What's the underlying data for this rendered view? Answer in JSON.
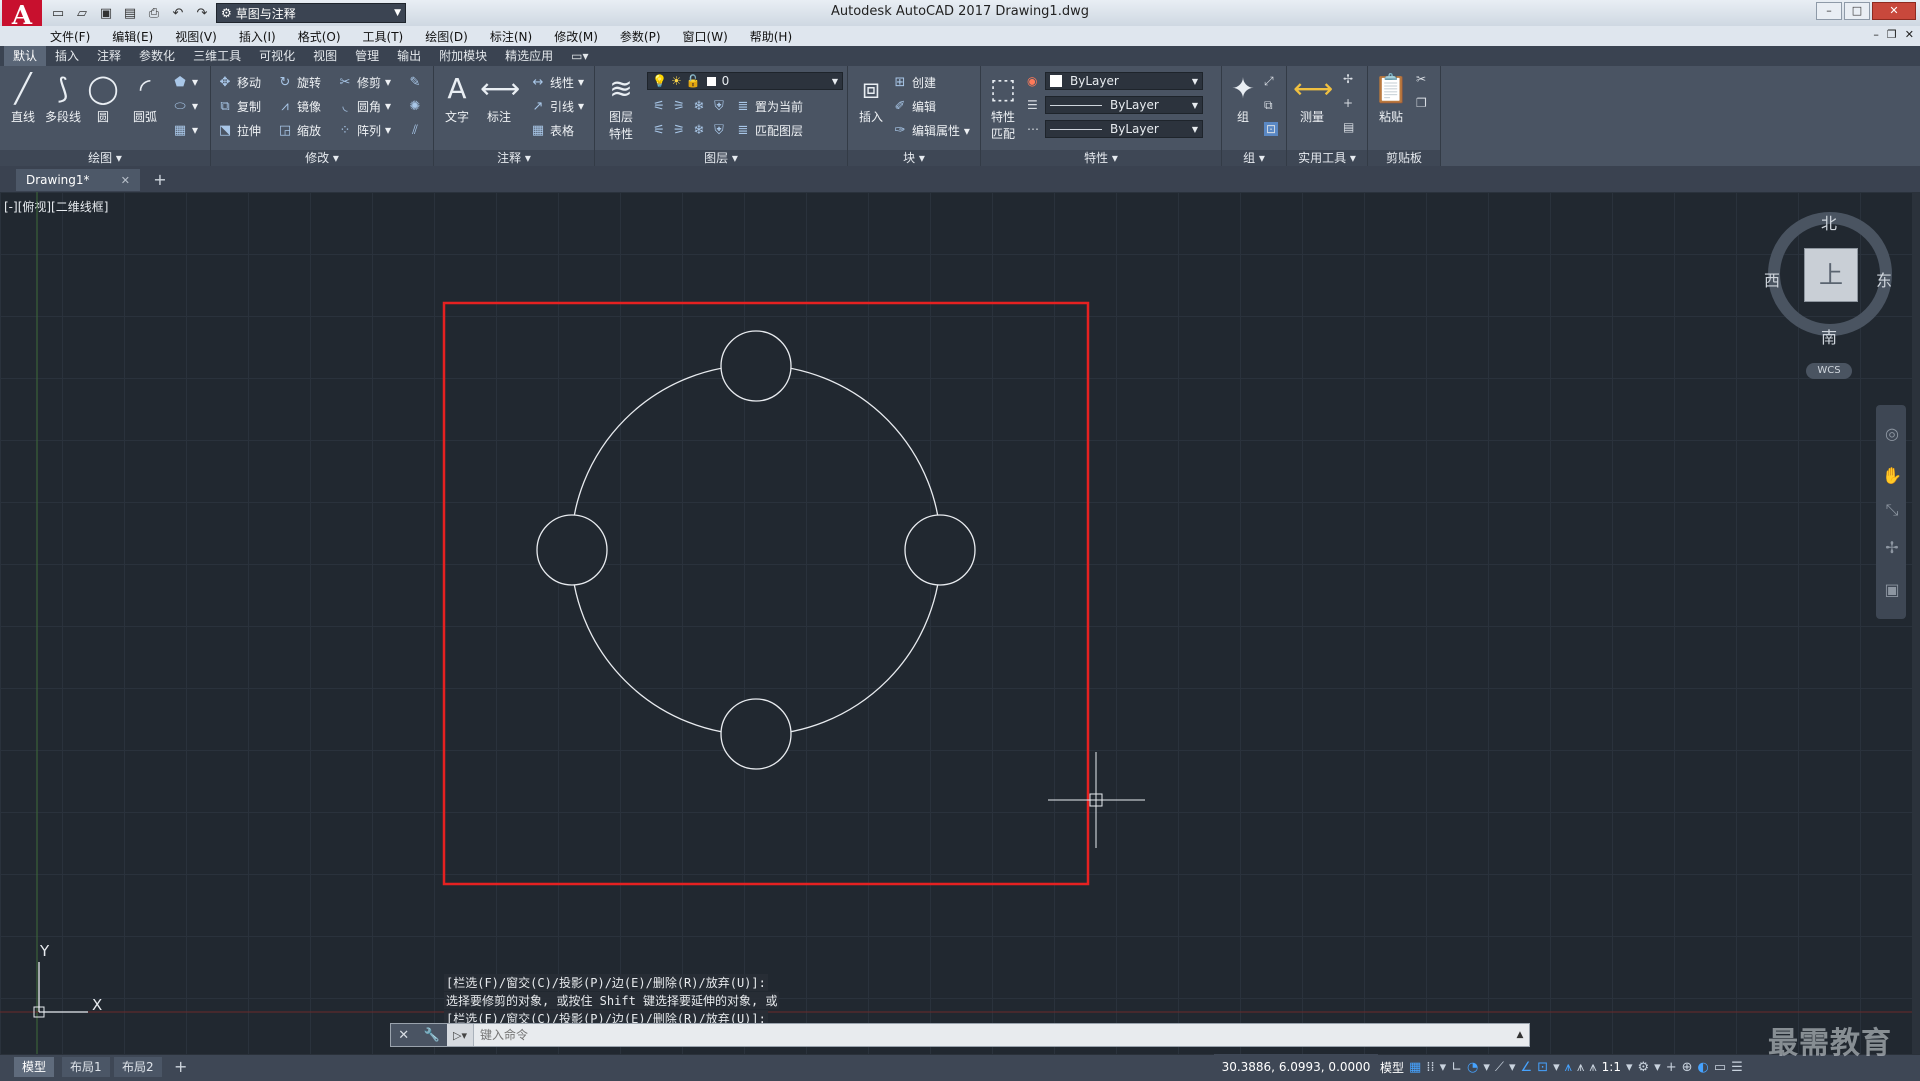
{
  "app": {
    "title": "Autodesk AutoCAD 2017    Drawing1.dwg",
    "logo": "A",
    "workspace": "草图与注释"
  },
  "menu": [
    "文件(F)",
    "编辑(E)",
    "视图(V)",
    "插入(I)",
    "格式(O)",
    "工具(T)",
    "绘图(D)",
    "标注(N)",
    "修改(M)",
    "参数(P)",
    "窗口(W)",
    "帮助(H)"
  ],
  "ribbon_tabs": [
    "默认",
    "插入",
    "注释",
    "参数化",
    "三维工具",
    "可视化",
    "视图",
    "管理",
    "输出",
    "附加模块",
    "精选应用"
  ],
  "panels": {
    "draw": {
      "title": "绘图 ▾",
      "line": "直线",
      "polyline": "多段线",
      "circle": "圆",
      "arc": "圆弧"
    },
    "modify": {
      "title": "修改 ▾",
      "move": "移动",
      "rotate": "旋转",
      "trim": "修剪",
      "copy": "复制",
      "mirror": "镜像",
      "fillet": "圆角",
      "stretch": "拉伸",
      "scale": "缩放",
      "array": "阵列"
    },
    "annotation": {
      "title": "注释 ▾",
      "text": "文字",
      "dimension": "标注",
      "linear": "线性",
      "leader": "引线",
      "table": "表格"
    },
    "layers": {
      "title": "图层 ▾",
      "layer_props": "图层\n特性",
      "layer_value": "0",
      "set_current": "置为当前",
      "match_layer": "匹配图层"
    },
    "block": {
      "title": "块 ▾",
      "insert": "插入",
      "create": "创建",
      "edit": "编辑",
      "edit_attr": "编辑属性 ▾"
    },
    "properties": {
      "title": "特性 ▾",
      "match": "特性\n匹配",
      "color": "ByLayer",
      "linetype": "ByLayer",
      "lineweight": "ByLayer"
    },
    "groups": {
      "title": "组 ▾",
      "group": "组"
    },
    "utilities": {
      "title": "实用工具 ▾",
      "measure": "测量"
    },
    "clipboard": {
      "title": "剪贴板",
      "paste": "粘贴"
    }
  },
  "doc_tab": {
    "name": "Drawing1*"
  },
  "viewport_label": "[-][俯视][二维线框]",
  "viewcube": {
    "face": "上",
    "north": "北",
    "south": "南",
    "east": "东",
    "west": "西",
    "wcs": "WCS"
  },
  "ucs": {
    "x": "X",
    "y": "Y"
  },
  "command_history": [
    "[栏选(F)/窗交(C)/投影(P)/边(E)/删除(R)/放弃(U)]:",
    "选择要修剪的对象, 或按住 Shift 键选择要延伸的对象, 或",
    "[栏选(F)/窗交(C)/投影(P)/边(E)/删除(R)/放弃(U)]:"
  ],
  "command_input": {
    "placeholder": "键入命令"
  },
  "layout_tabs": [
    "模型",
    "布局1",
    "布局2"
  ],
  "status": {
    "coords": "30.3886, 6.0993, 0.0000",
    "model": "模型",
    "scale": "1:1"
  },
  "watermark": "最需教育"
}
